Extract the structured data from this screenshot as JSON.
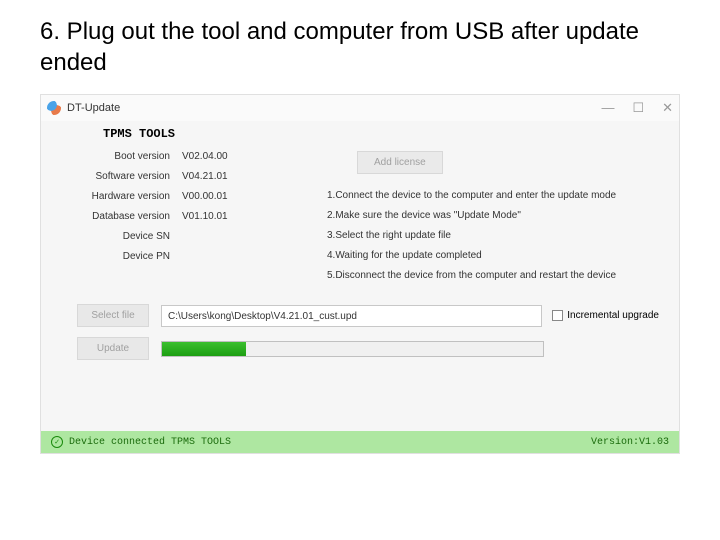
{
  "slide_instruction": "6. Plug out the tool and computer from USB after update ended",
  "window": {
    "title": "DT-Update"
  },
  "header": {
    "title": "TPMS TOOLS"
  },
  "info": {
    "boot_label": "Boot   version",
    "boot_value": "V02.04.00",
    "software_label": "Software version",
    "software_value": "V04.21.01",
    "hardware_label": "Hardware version",
    "hardware_value": "V00.00.01",
    "database_label": "Database version",
    "database_value": "V01.10.01",
    "sn_label": "Device SN",
    "sn_value": "",
    "pn_label": "Device PN",
    "pn_value": ""
  },
  "buttons": {
    "add_license": "Add license",
    "select_file": "Select file",
    "update": "Update"
  },
  "instructions": {
    "i1": "1.Connect the device to the computer and enter the update mode",
    "i2": "2.Make sure the device was \"Update Mode\"",
    "i3": "3.Select the right update file",
    "i4": "4.Waiting for the update completed",
    "i5": "5.Disconnect the device from the computer and restart the device"
  },
  "file_path": "C:\\Users\\kong\\Desktop\\V4.21.01_cust.upd",
  "incremental_label": "Incremental upgrade",
  "progress_percent": 22,
  "status": {
    "text": "Device connected TPMS TOOLS",
    "version": "Version:V1.03"
  }
}
